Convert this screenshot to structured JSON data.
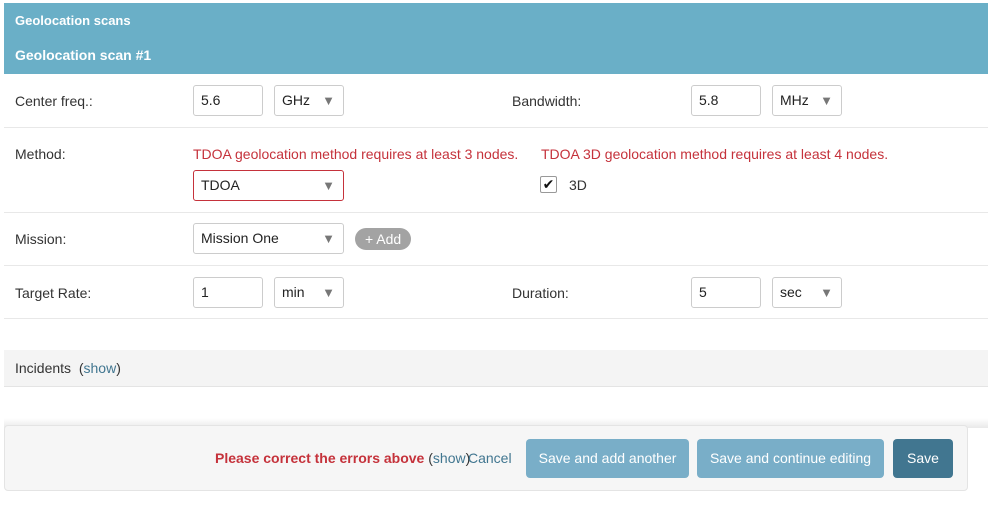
{
  "header": {
    "section_title": "Geolocation scans",
    "item_title": "Geolocation scan #1"
  },
  "fields": {
    "center_freq": {
      "label": "Center freq.:",
      "value": "5.6",
      "unit": "GHz"
    },
    "bandwidth": {
      "label": "Bandwidth:",
      "value": "5.8",
      "unit": "MHz"
    },
    "method": {
      "label": "Method:",
      "error": "TDOA geolocation method requires at least 3 nodes.",
      "value": "TDOA",
      "error_3d": "TDOA 3D geolocation method requires at least 4 nodes.",
      "checkbox_label": "3D",
      "checkbox_checked": true,
      "check_mark": "✔"
    },
    "mission": {
      "label": "Mission:",
      "value": "Mission One",
      "add_label": "+ Add"
    },
    "target_rate": {
      "label": "Target Rate:",
      "value": "1",
      "unit": "min"
    },
    "duration": {
      "label": "Duration:",
      "value": "5",
      "unit": "sec"
    }
  },
  "incidents": {
    "title": "Incidents",
    "show_link": "show",
    "open_paren": "(",
    "close_paren": ")"
  },
  "submit_row": {
    "error_text": "Please correct the errors above",
    "show_link": "show",
    "open_paren": "(",
    "close_paren": ")",
    "cancel": "Cancel",
    "save_add_another": "Save and add another",
    "save_continue": "Save and continue editing",
    "save": "Save"
  },
  "icons": {
    "dropdown_arrow": "▼"
  }
}
